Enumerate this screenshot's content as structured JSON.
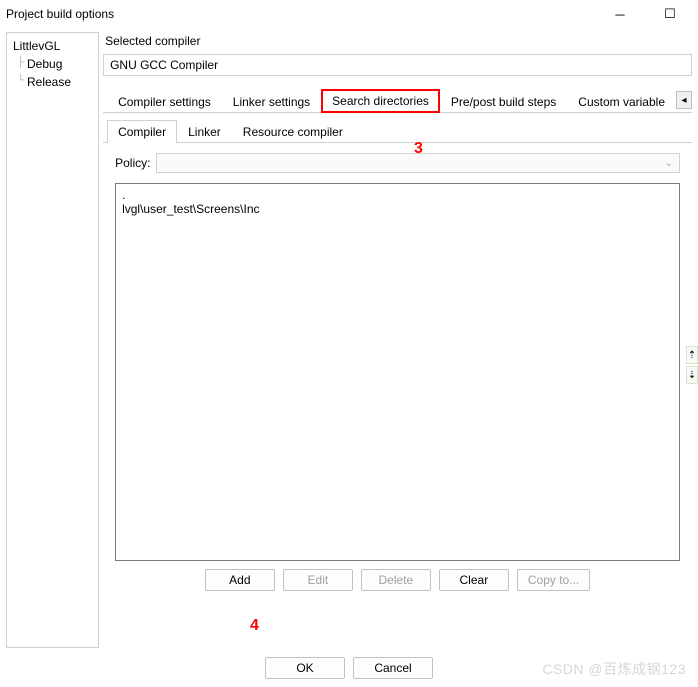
{
  "window": {
    "title": "Project build options"
  },
  "tree": {
    "root": "LittlevGL",
    "children": [
      "Debug",
      "Release"
    ]
  },
  "compiler": {
    "label": "Selected compiler",
    "value": "GNU GCC Compiler"
  },
  "tabs_top": [
    {
      "label": "Compiler settings",
      "active": false
    },
    {
      "label": "Linker settings",
      "active": false
    },
    {
      "label": "Search directories",
      "active": true,
      "highlight": true
    },
    {
      "label": "Pre/post build steps",
      "active": false
    },
    {
      "label": "Custom variable",
      "active": false
    }
  ],
  "tabs_sub": [
    {
      "label": "Compiler",
      "active": true
    },
    {
      "label": "Linker",
      "active": false
    },
    {
      "label": "Resource compiler",
      "active": false
    }
  ],
  "policy": {
    "label": "Policy:",
    "value": ""
  },
  "directories": [
    ".",
    "lvgl\\user_test\\Screens\\Inc"
  ],
  "dir_buttons": {
    "add": "Add",
    "edit": "Edit",
    "delete": "Delete",
    "clear": "Clear",
    "copyto": "Copy to..."
  },
  "dialog_buttons": {
    "ok": "OK",
    "cancel": "Cancel"
  },
  "annotations": {
    "step3": "3",
    "step4": "4"
  },
  "watermark": "CSDN @百炼成钢123"
}
